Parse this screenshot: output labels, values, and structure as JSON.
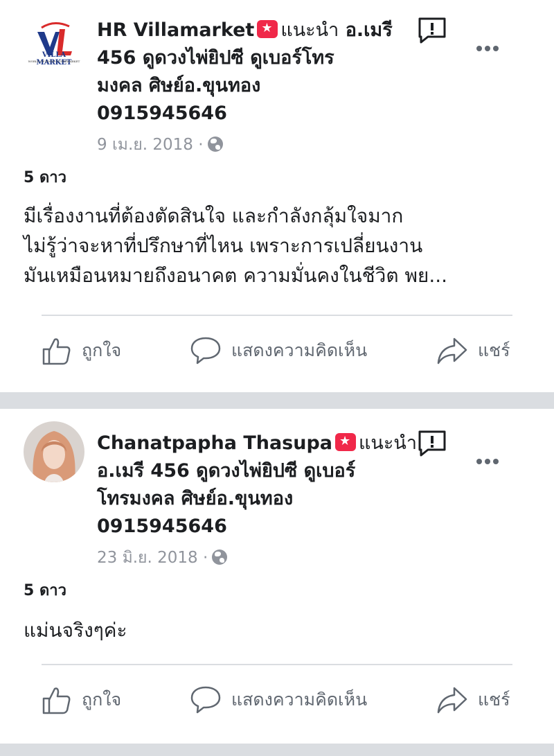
{
  "posts": [
    {
      "author": "HR Villamarket",
      "recommend_label": "แนะนำ",
      "recommend_text_line1": "อ.เมรี",
      "review_lines": [
        "456 ดูดวงไพ่ยิปซี ดูเบอร์โทร",
        "มงคล ศิษย์อ.ขุนทอง",
        "0915945646"
      ],
      "logo_text": "VILLA MARKET",
      "logo_subtext": "WORLD OF FOODS SUPERMARKET",
      "date": "9 เม.ย. 2018 ·",
      "rating": "5 ดาว",
      "body": [
        "มีเรื่องงานที่ต้องตัดสินใจ  และกำลังกลุ้มใจมาก",
        "ไม่รู้ว่าจะหาที่ปรึกษาที่ไหน เพราะการเปลี่ยนงาน",
        "มันเหมือนหมายถึงอนาคต ความมั่นคงในชีวิต พย..."
      ]
    },
    {
      "author": "Chanatpapha Thasupa",
      "recommend_label": "แนะนำ",
      "review_lines": [
        "อ.เมรี 456 ดูดวงไพ่ยิปซี ดูเบอร์",
        "โทรมงคล ศิษย์อ.ขุนทอง",
        "0915945646"
      ],
      "date": "23 มิ.ย. 2018 ·",
      "rating": "5 ดาว",
      "body": [
        "แม่นจริงๆค่ะ"
      ]
    }
  ],
  "actions": {
    "like": "ถูกใจ",
    "comment": "แสดงความคิดเห็น",
    "share": "แชร์"
  },
  "icons": [
    "star-icon",
    "report-icon",
    "more-icon",
    "globe-icon",
    "like-icon",
    "comment-icon",
    "share-icon"
  ],
  "colors": {
    "badge": "#f02849",
    "meta": "#90949c",
    "action": "#606770",
    "separator": "#dadde1"
  }
}
